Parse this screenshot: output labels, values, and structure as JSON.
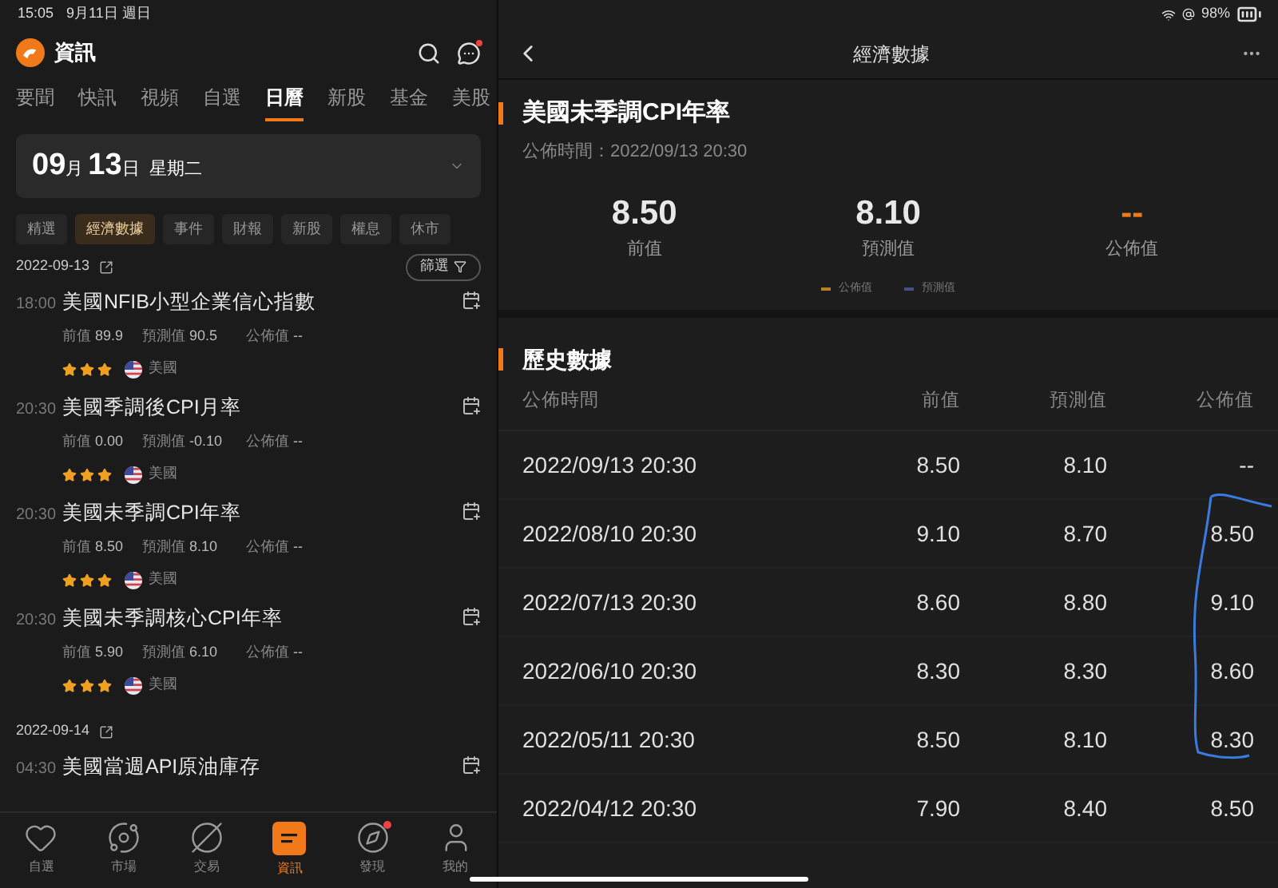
{
  "status_bar": {
    "time": "15:05",
    "date": "9月11日 週日",
    "battery": "98%"
  },
  "news_panel": {
    "title": "資訊",
    "tabs": [
      {
        "label": "要聞",
        "selected": false
      },
      {
        "label": "快訊",
        "selected": false
      },
      {
        "label": "視頻",
        "selected": false
      },
      {
        "label": "自選",
        "selected": false
      },
      {
        "label": "日曆",
        "selected": true
      },
      {
        "label": "新股",
        "selected": false
      },
      {
        "label": "基金",
        "selected": false
      },
      {
        "label": "美股",
        "selected": false
      }
    ],
    "date_picker": {
      "month": "09",
      "month_unit": "月",
      "day": "13",
      "day_unit": "日",
      "weekday": "星期二"
    },
    "filters": [
      {
        "label": "精選",
        "selected": false
      },
      {
        "label": "經濟數據",
        "selected": true
      },
      {
        "label": "事件",
        "selected": false
      },
      {
        "label": "財報",
        "selected": false
      },
      {
        "label": "新股",
        "selected": false
      },
      {
        "label": "權息",
        "selected": false
      },
      {
        "label": "休市",
        "selected": false
      }
    ],
    "filter_button": "篩選",
    "days": [
      {
        "date": "2022-09-13",
        "events": [
          {
            "time": "18:00",
            "title": "美國NFIB小型企業信心指數",
            "prev_label": "前值",
            "prev": "89.9",
            "forecast_label": "預測值",
            "forecast": "90.5",
            "actual_label": "公佈值",
            "actual": "--",
            "stars": 3,
            "country": "美國"
          },
          {
            "time": "20:30",
            "title": "美國季調後CPI月率",
            "prev_label": "前值",
            "prev": "0.00",
            "forecast_label": "預測值",
            "forecast": "-0.10",
            "actual_label": "公佈值",
            "actual": "--",
            "stars": 3,
            "country": "美國"
          },
          {
            "time": "20:30",
            "title": "美國未季調CPI年率",
            "prev_label": "前值",
            "prev": "8.50",
            "forecast_label": "預測值",
            "forecast": "8.10",
            "actual_label": "公佈值",
            "actual": "--",
            "stars": 3,
            "country": "美國"
          },
          {
            "time": "20:30",
            "title": "美國未季調核心CPI年率",
            "prev_label": "前值",
            "prev": "5.90",
            "forecast_label": "預測值",
            "forecast": "6.10",
            "actual_label": "公佈值",
            "actual": "--",
            "stars": 3,
            "country": "美國"
          }
        ]
      },
      {
        "date": "2022-09-14",
        "events": [
          {
            "time": "04:30",
            "title": "美國當週API原油庫存"
          }
        ]
      }
    ],
    "bottom_nav": [
      {
        "label": "自選",
        "selected": false,
        "badge": false
      },
      {
        "label": "市場",
        "selected": false,
        "badge": false
      },
      {
        "label": "交易",
        "selected": false,
        "badge": false
      },
      {
        "label": "資訊",
        "selected": true,
        "badge": false
      },
      {
        "label": "發現",
        "selected": false,
        "badge": true
      },
      {
        "label": "我的",
        "selected": false,
        "badge": false
      }
    ]
  },
  "detail_panel": {
    "nav_title": "經濟數據",
    "indicator": "美國未季調CPI年率",
    "publish_time": "公佈時間：2022/09/13 20:30",
    "stats": [
      {
        "value": "8.50",
        "label": "前值",
        "highlight": false
      },
      {
        "value": "8.10",
        "label": "預測值",
        "highlight": false
      },
      {
        "value": "--",
        "label": "公佈值",
        "highlight": true
      }
    ],
    "legend": [
      {
        "label": "公佈值",
        "color": "#b8802a"
      },
      {
        "label": "預測值",
        "color": "#45508a"
      }
    ],
    "history": {
      "title": "歷史數據",
      "columns": [
        "公佈時間",
        "前值",
        "預測值",
        "公佈值"
      ],
      "rows": [
        [
          "2022/09/13 20:30",
          "8.50",
          "8.10",
          "--"
        ],
        [
          "2022/08/10 20:30",
          "9.10",
          "8.70",
          "8.50"
        ],
        [
          "2022/07/13 20:30",
          "8.60",
          "8.80",
          "9.10"
        ],
        [
          "2022/06/10 20:30",
          "8.30",
          "8.30",
          "8.60"
        ],
        [
          "2022/05/11 20:30",
          "8.50",
          "8.10",
          "8.30"
        ],
        [
          "2022/04/12 20:30",
          "7.90",
          "8.40",
          "8.50"
        ]
      ]
    }
  }
}
